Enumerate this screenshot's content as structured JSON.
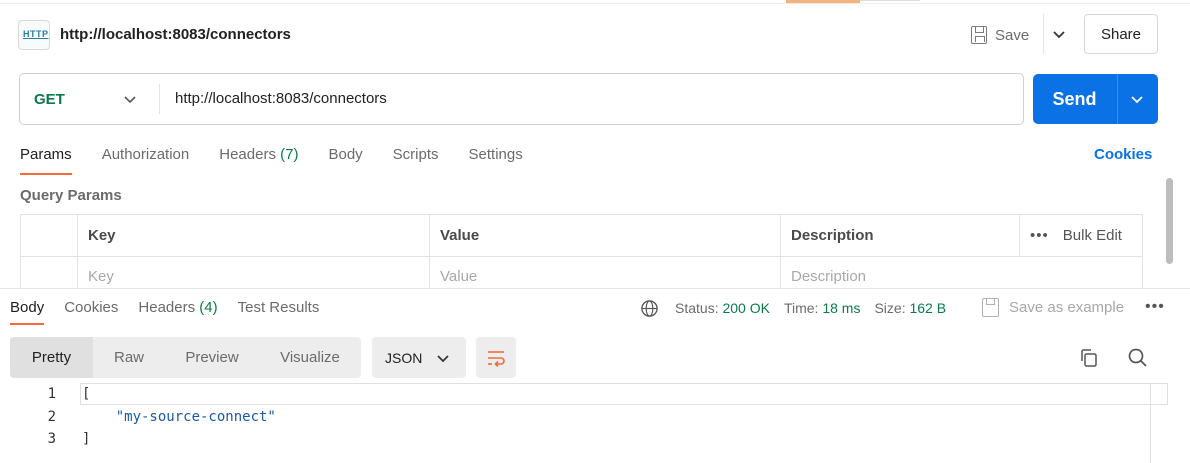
{
  "header": {
    "title": "http://localhost:8083/connectors",
    "http_icon_label": "HTTP",
    "save_label": "Save",
    "share_label": "Share"
  },
  "request": {
    "method": "GET",
    "url": "http://localhost:8083/connectors",
    "send_label": "Send",
    "tabs": [
      {
        "label": "Params",
        "count": ""
      },
      {
        "label": "Authorization",
        "count": ""
      },
      {
        "label": "Headers",
        "count": "(7)"
      },
      {
        "label": "Body",
        "count": ""
      },
      {
        "label": "Scripts",
        "count": ""
      },
      {
        "label": "Settings",
        "count": ""
      }
    ],
    "cookies_link": "Cookies"
  },
  "params": {
    "title": "Query Params",
    "columns": {
      "key": "Key",
      "value": "Value",
      "description": "Description",
      "bulk_edit": "Bulk Edit"
    },
    "placeholders": {
      "key": "Key",
      "value": "Value",
      "description": "Description"
    }
  },
  "response": {
    "tabs": [
      {
        "label": "Body",
        "count": ""
      },
      {
        "label": "Cookies",
        "count": ""
      },
      {
        "label": "Headers",
        "count": "(4)"
      },
      {
        "label": "Test Results",
        "count": ""
      }
    ],
    "status_label": "Status:",
    "status_value": "200 OK",
    "time_label": "Time:",
    "time_value": "18 ms",
    "size_label": "Size:",
    "size_value": "162 B",
    "save_example": "Save as example",
    "formats": [
      "Pretty",
      "Raw",
      "Preview",
      "Visualize"
    ],
    "format_selected": "JSON",
    "code_lines": [
      {
        "num": "1",
        "text": "["
      },
      {
        "num": "2",
        "text": "    \"my-source-connect\""
      },
      {
        "num": "3",
        "text": "]"
      }
    ]
  },
  "colors": {
    "accent": "#f26b3a",
    "send_blue": "#0a72e4",
    "method_green": "#0b7a4b"
  }
}
